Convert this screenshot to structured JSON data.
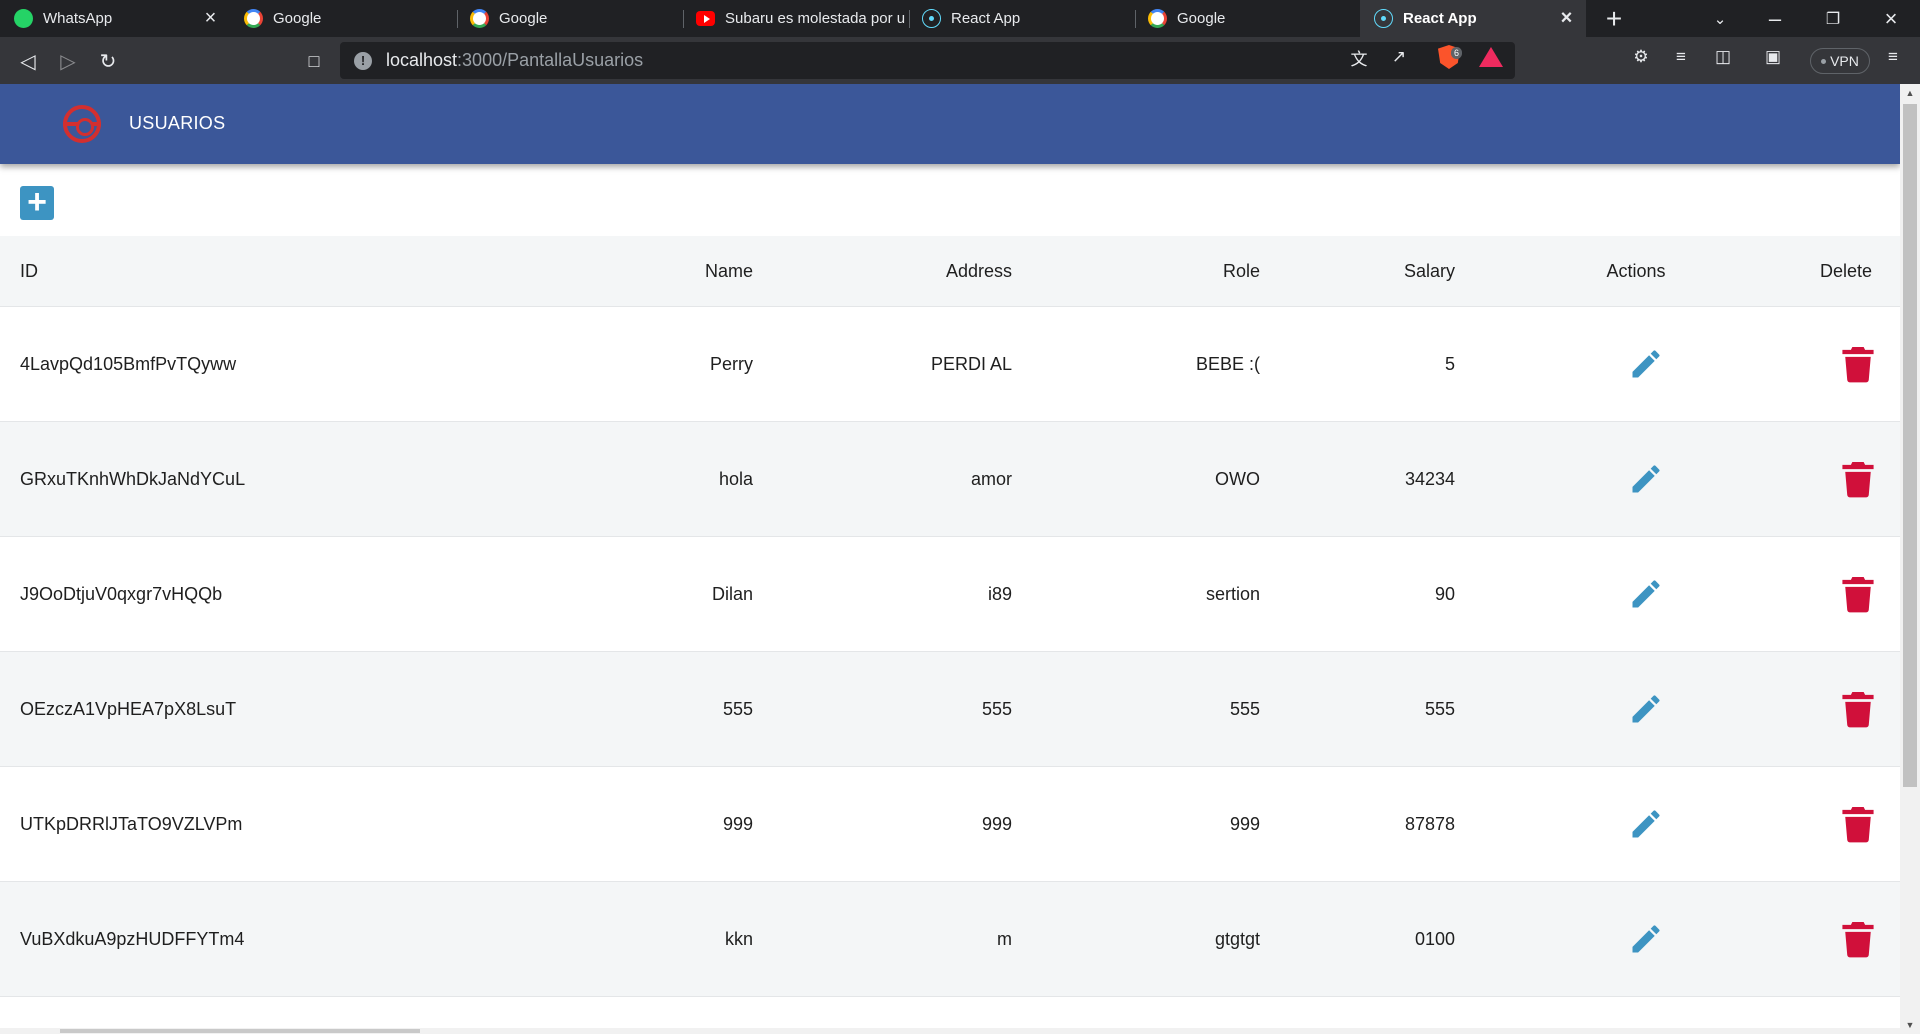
{
  "browser": {
    "tabs": [
      {
        "title": "WhatsApp",
        "favicon": "whatsapp-icon"
      },
      {
        "title": "Google",
        "favicon": "google-icon"
      },
      {
        "title": "Google",
        "favicon": "google-icon"
      },
      {
        "title": "Subaru es molestada por u",
        "favicon": "youtube-icon"
      },
      {
        "title": "React App",
        "favicon": "react-icon"
      },
      {
        "title": "Google",
        "favicon": "google-icon"
      },
      {
        "title": "React App",
        "favicon": "react-icon",
        "active": true
      }
    ],
    "url_host": "localhost",
    "url_path": ":3000/PantallaUsuarios",
    "shields_count": "6",
    "vpn_label": "VPN"
  },
  "app": {
    "title": "USUARIOS",
    "add_label": "+"
  },
  "table": {
    "columns": [
      "ID",
      "Name",
      "Address",
      "Role",
      "Salary",
      "Actions",
      "Delete"
    ],
    "rows": [
      {
        "id": "4LavpQd105BmfPvTQyww",
        "name": "Perry",
        "address": "PERDI AL",
        "role": "BEBE :(",
        "salary": "5"
      },
      {
        "id": "GRxuTKnhWhDkJaNdYCuL",
        "name": "hola",
        "address": "amor",
        "role": "OWO",
        "salary": "34234"
      },
      {
        "id": "J9OoDtjuV0qxgr7vHQQb",
        "name": "Dilan",
        "address": "i89",
        "role": "sertion",
        "salary": "90"
      },
      {
        "id": "OEzczA1VpHEA7pX8LsuT",
        "name": "555",
        "address": "555",
        "role": "555",
        "salary": "555"
      },
      {
        "id": "UTKpDRRlJTaTO9VZLVPm",
        "name": "999",
        "address": "999",
        "role": "999",
        "salary": "87878"
      },
      {
        "id": "VuBXdkuA9pzHUDFFYTm4",
        "name": "kkn",
        "address": "m",
        "role": "gtgtgt",
        "salary": "0100"
      }
    ]
  },
  "colors": {
    "header_bg": "#3b5799",
    "edit_icon": "#3d94c2",
    "delete_icon": "#d0103a",
    "row_alt": "#f4f6f7"
  }
}
